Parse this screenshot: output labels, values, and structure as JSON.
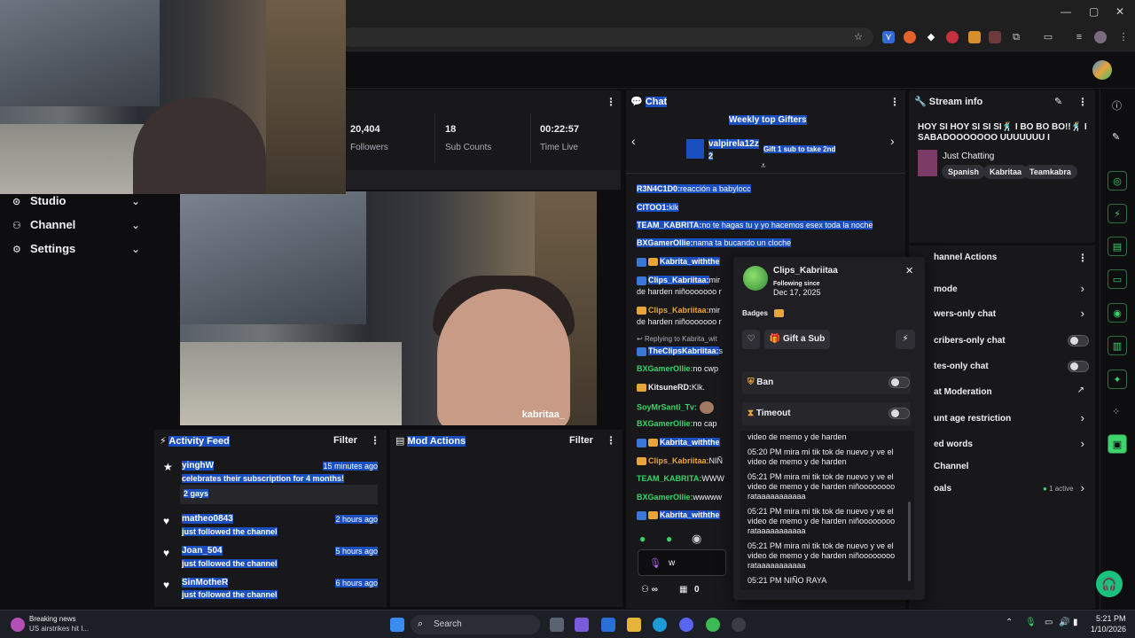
{
  "stats": {
    "followers_value": "20,404",
    "followers_label": "Followers",
    "subs_value": "18",
    "subs_label": "Sub Counts",
    "time_value": "00:22:57",
    "time_label": "Time Live"
  },
  "sidebar": {
    "items": [
      {
        "label": "Studio"
      },
      {
        "label": "Channel"
      },
      {
        "label": "Settings"
      }
    ]
  },
  "video": {
    "watermark": "kabritaa_"
  },
  "activity": {
    "title": "Activity Feed",
    "filter": "Filter",
    "items": [
      {
        "name": "yinghW",
        "time": "15 minutes ago",
        "desc": "celebrates their subscription for 4 months!",
        "note": "2 gays"
      },
      {
        "name": "matheo0843",
        "time": "2 hours ago",
        "desc": "just followed the channel"
      },
      {
        "name": "Joan_504",
        "time": "5 hours ago",
        "desc": "just followed the channel"
      },
      {
        "name": "SinMotheR",
        "time": "6 hours ago",
        "desc": "just followed the channel"
      }
    ]
  },
  "mod": {
    "title": "Mod Actions",
    "filter": "Filter"
  },
  "chat": {
    "title": "Chat",
    "gifters_title": "Weekly top Gifters",
    "gifter_name": "valpirela12z",
    "gifter_count": "2",
    "gifter_cta": "Gift 1 sub to take 2nd",
    "lines": [
      {
        "user": "R3N4C1D0:",
        "text": "reacción a babylocc"
      },
      {
        "user": "CITOO1:",
        "text": "klk"
      },
      {
        "user": "TEAM_KABRITA:",
        "text": "no te hagas tu y yo hacemos esex toda la noche"
      },
      {
        "user": "BXGamerOllie:",
        "text": "nama ta bucando un cloche"
      },
      {
        "user": "Kabrita_withthe",
        "text": ""
      },
      {
        "user": "Clips_Kabriitaa:",
        "text": "mir"
      },
      {
        "user": "",
        "text": "de harden niñooooooo r"
      },
      {
        "user": "Clips_Kabriitaa:",
        "text": "mir"
      },
      {
        "user": "",
        "text": "de harden niñooooooo r"
      },
      {
        "user": "",
        "text": "Replying to Kabrita_wit"
      },
      {
        "user": "TheClipsKabriitaa:",
        "text": "s"
      },
      {
        "user": "BXGamerOllie:",
        "text": "no cwp"
      },
      {
        "user": "KitsuneRD:",
        "text": "Klk."
      },
      {
        "user": "SoyMrSanti_Tv:",
        "text": ""
      },
      {
        "user": "BXGamerOllie:",
        "text": "no cap"
      },
      {
        "user": "Kabrita_withthe",
        "text": ""
      },
      {
        "user": "Clips_Kabriitaa:",
        "text": "NIÑ"
      },
      {
        "user": "TEAM_KABRITA:",
        "text": "WWW"
      },
      {
        "user": "BXGamerOllie:",
        "text": "wwwww"
      },
      {
        "user": "Kabrita_withthe",
        "text": ""
      }
    ],
    "input_value": "w",
    "points": "0"
  },
  "streaminfo": {
    "title": "Stream info",
    "stream_title": "HOY SI HOY SI SI SI🕺 I BO BO BO!!🕺 I SABADOOOOOOO UUUUUUU I",
    "category": "Just Chatting",
    "tags": [
      "Spanish",
      "Kabritaa",
      "Teamkabra"
    ]
  },
  "chanactions": {
    "title": "hannel Actions",
    "rows": [
      {
        "label": "mode"
      },
      {
        "label": "wers-only chat"
      },
      {
        "label": "cribers-only chat"
      },
      {
        "label": "tes-only chat"
      },
      {
        "label": "at Moderation"
      },
      {
        "label": "unt age restriction"
      },
      {
        "label": "ed words"
      },
      {
        "label": "Channel"
      },
      {
        "label": "oals"
      }
    ],
    "goals_status": "1 active"
  },
  "usercard": {
    "username": "Clips_Kabriitaa",
    "following_label": "Following since",
    "following_date": "Dec 17, 2025",
    "badges_label": "Badges",
    "gift_label": "Gift a Sub",
    "ban_label": "Ban",
    "timeout_label": "Timeout",
    "messages": [
      "video de memo y de harden",
      "05:20 PM mira mi tik tok de nuevo y ve el video de memo y de harden",
      "05:21 PM mira mi tik tok de nuevo y ve el video de memo y de harden niñoooooooo rataaaaaaaaaaa",
      "05:21 PM mira mi tik tok de nuevo y ve el video de memo y de harden niñoooooooo rataaaaaaaaaaa",
      "05:21 PM mira mi tik tok de nuevo y ve el video de memo y de harden niñoooooooo rataaaaaaaaaaa",
      "05:21 PM NIÑO RAYA"
    ]
  },
  "taskbar": {
    "news_title": "Breaking news",
    "news_sub": "US airstrikes hit I...",
    "search_label": "Search",
    "time": "5:21 PM",
    "date": "1/10/2026"
  },
  "colors": {
    "accent_green": "#3cd46b",
    "selection": "#1b4fbf",
    "crown": "#e8a53a"
  }
}
